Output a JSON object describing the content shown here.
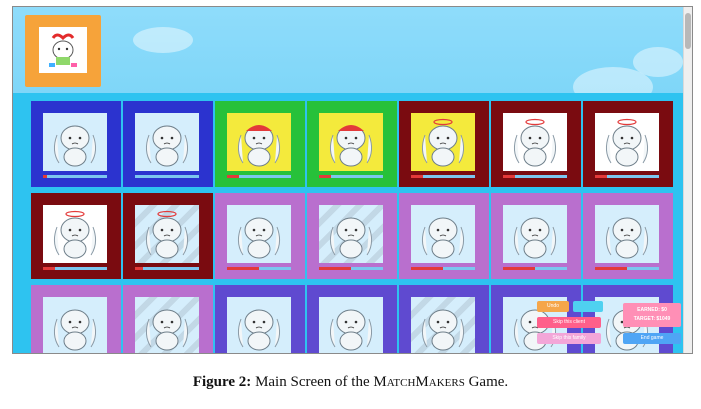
{
  "caption": {
    "label": "Figure 2:",
    "text_before": "Main Screen of the",
    "game_name": "MatchMakers",
    "text_after": "Game."
  },
  "profile": {
    "icon": "bunny-avatar-icon",
    "color": "#f6a33a"
  },
  "palette": {
    "blue": "#2b33cf",
    "yellow_green": "#27c13a",
    "dark_red": "#7a0b10",
    "purple": "#b96fce",
    "indigo": "#5f4ad0"
  },
  "grid": {
    "rows": [
      [
        {
          "frame": "blue",
          "pic": "#d5eefc",
          "hat": "none",
          "progress": 0.06
        },
        {
          "frame": "blue",
          "pic": "#d5eefc",
          "hat": "none",
          "progress": 0.0
        },
        {
          "frame": "yellow_green",
          "pic": "#f4ea3c",
          "hat": "red-cap",
          "progress": 0.18
        },
        {
          "frame": "yellow_green",
          "pic": "#f4ea3c",
          "hat": "red-cap",
          "progress": 0.18
        },
        {
          "frame": "dark_red",
          "pic": "#f4ea3c",
          "hat": "halo",
          "progress": 0.18
        },
        {
          "frame": "dark_red",
          "pic": "#ffffff",
          "hat": "halo",
          "progress": 0.18
        },
        {
          "frame": "dark_red",
          "pic": "#ffffff",
          "hat": "halo",
          "progress": 0.18
        }
      ],
      [
        {
          "frame": "dark_red",
          "pic": "#ffffff",
          "hat": "halo",
          "progress": 0.18
        },
        {
          "frame": "dark_red",
          "pic": "stripe",
          "hat": "halo",
          "progress": 0.12
        },
        {
          "frame": "purple",
          "pic": "#d5eefc",
          "hat": "none",
          "progress": 0.5
        },
        {
          "frame": "purple",
          "pic": "stripe",
          "hat": "none",
          "progress": 0.5
        },
        {
          "frame": "purple",
          "pic": "#d5eefc",
          "hat": "none",
          "progress": 0.5
        },
        {
          "frame": "purple",
          "pic": "#d5eefc",
          "hat": "none",
          "progress": 0.5
        },
        {
          "frame": "purple",
          "pic": "#d5eefc",
          "hat": "none",
          "progress": 0.5
        }
      ],
      [
        {
          "frame": "purple",
          "pic": "#d5eefc",
          "hat": "none",
          "progress": 0.5
        },
        {
          "frame": "purple",
          "pic": "stripe",
          "hat": "none",
          "progress": 0.5
        },
        {
          "frame": "indigo",
          "pic": "#d5eefc",
          "hat": "none",
          "progress": 0.5
        },
        {
          "frame": "indigo",
          "pic": "#d5eefc",
          "hat": "none",
          "progress": 0.5
        },
        {
          "frame": "indigo",
          "pic": "stripe",
          "hat": "none",
          "progress": 0.5
        },
        {
          "frame": "indigo",
          "pic": "#d5eefc",
          "hat": "none",
          "progress": 0.5
        },
        {
          "frame": "indigo",
          "pic": "#d5eefc",
          "hat": "none",
          "progress": 0.5
        }
      ]
    ]
  },
  "hud": {
    "undo_label": "Undo",
    "skip_client_label": "Skip this client",
    "skip_family_label": "Skip this family",
    "earned_label": "EARNED: $0",
    "target_label": "TARGET: $1049",
    "end_game_label": "End game"
  }
}
